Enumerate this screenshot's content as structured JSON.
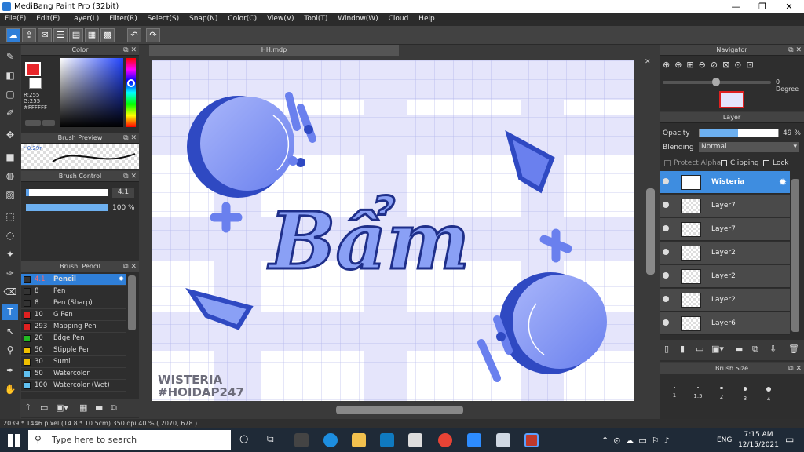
{
  "window": {
    "title": "MediBang Paint Pro (32bit)",
    "minimize": "—",
    "restore": "❐",
    "close": "✕"
  },
  "menu": [
    "File(F)",
    "Edit(E)",
    "Layer(L)",
    "Filter(R)",
    "Select(S)",
    "Snap(N)",
    "Color(C)",
    "View(V)",
    "Tool(T)",
    "Window(W)",
    "Cloud",
    "Help"
  ],
  "panels": {
    "color": {
      "title": "Color",
      "r": "R:255",
      "g": "G:255",
      "hex": "#FFFFFF",
      "primary": "#e8262b",
      "secondary": "#ffffff"
    },
    "brush_preview": {
      "title": "Brush Preview",
      "size": "* 0.29r"
    },
    "brush_control": {
      "title": "Brush Control",
      "size_value": "4.1",
      "opacity_value": "100 %"
    },
    "brush_list": {
      "title": "Brush: Pencil",
      "items": [
        {
          "size": "4.1",
          "name": "Pencil",
          "color": "#333333",
          "selected": true
        },
        {
          "size": "8",
          "name": "Pen",
          "color": "#333333"
        },
        {
          "size": "8",
          "name": "Pen (Sharp)",
          "color": "#333333"
        },
        {
          "size": "10",
          "name": "G Pen",
          "color": "#e02020"
        },
        {
          "size": "293",
          "name": "Mapping Pen",
          "color": "#e02020"
        },
        {
          "size": "20",
          "name": "Edge Pen",
          "color": "#22bb22"
        },
        {
          "size": "50",
          "name": "Stipple Pen",
          "color": "#f0c000"
        },
        {
          "size": "30",
          "name": "Sumi",
          "color": "#f0c000"
        },
        {
          "size": "50",
          "name": "Watercolor",
          "color": "#60c0f0"
        },
        {
          "size": "100",
          "name": "Watercolor (Wet)",
          "color": "#60c0f0"
        }
      ]
    },
    "navigator": {
      "title": "Navigator",
      "rotation": "0 Degree"
    },
    "layer": {
      "title": "Layer",
      "opacity_label": "Opacity",
      "opacity_value": "49 %",
      "opacity_fraction": 0.49,
      "blending_label": "Blending",
      "blending_value": "Normal",
      "protect_alpha": "Protect Alpha",
      "clipping": "Clipping",
      "lock": "Lock",
      "layers": [
        {
          "name": "Wisteria",
          "selected": true
        },
        {
          "name": "Layer7"
        },
        {
          "name": "Layer7"
        },
        {
          "name": "Layer2"
        },
        {
          "name": "Layer2"
        },
        {
          "name": "Layer2"
        },
        {
          "name": "Layer6"
        }
      ]
    },
    "brush_size": {
      "title": "Brush Size",
      "sizes": [
        "1",
        "1.5",
        "2",
        "3",
        "4"
      ]
    }
  },
  "document": {
    "tab": "HH.mdp",
    "artwork_text": "Bẩm",
    "watermark_line1": "WISTERIA",
    "watermark_line2": "#HOIDAP247"
  },
  "status": "2039 * 1446 pixel  (14.8 * 10.5cm)  350 dpi  40 %  ( 2070, 678 )",
  "taskbar": {
    "search_placeholder": "Type here to search",
    "lang": "ENG",
    "time": "7:15 AM",
    "date": "12/15/2021"
  },
  "colors": {
    "accent": "#2f7fd8",
    "art_dark": "#2f49c2",
    "art_light": "#8aa0f5",
    "art_bg": "#e4e4fb"
  }
}
